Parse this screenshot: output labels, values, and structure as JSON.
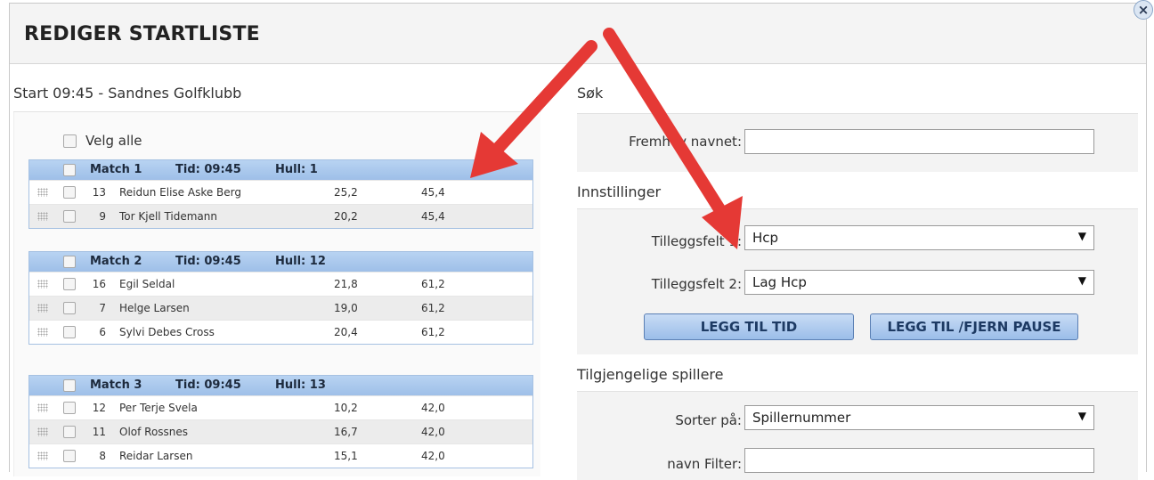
{
  "dialog": {
    "title": "REDIGER STARTLISTE",
    "close_glyph": "×"
  },
  "left": {
    "heading": "Start 09:45 - Sandnes Golfklubb",
    "select_all_label": "Velg alle",
    "matches": [
      {
        "match": "Match 1",
        "time": "Tid: 09:45",
        "hole": "Hull: 1",
        "players": [
          {
            "num": "13",
            "name": "Reidun Elise Aske Berg",
            "hcp": "25,2",
            "lag": "45,4"
          },
          {
            "num": "9",
            "name": "Tor Kjell Tidemann",
            "hcp": "20,2",
            "lag": "45,4"
          }
        ]
      },
      {
        "match": "Match 2",
        "time": "Tid: 09:45",
        "hole": "Hull: 12",
        "players": [
          {
            "num": "16",
            "name": "Egil Seldal",
            "hcp": "21,8",
            "lag": "61,2"
          },
          {
            "num": "7",
            "name": "Helge Larsen",
            "hcp": "19,0",
            "lag": "61,2"
          },
          {
            "num": "6",
            "name": "Sylvi Debes Cross",
            "hcp": "20,4",
            "lag": "61,2"
          }
        ]
      },
      {
        "match": "Match 3",
        "time": "Tid: 09:45",
        "hole": "Hull: 13",
        "players": [
          {
            "num": "12",
            "name": "Per Terje Svela",
            "hcp": "10,2",
            "lag": "42,0"
          },
          {
            "num": "11",
            "name": "Olof Rossnes",
            "hcp": "16,7",
            "lag": "42,0"
          },
          {
            "num": "8",
            "name": "Reidar Larsen",
            "hcp": "15,1",
            "lag": "42,0"
          }
        ]
      }
    ]
  },
  "right": {
    "search": {
      "heading": "Søk",
      "label": "Fremhev navnet:",
      "value": ""
    },
    "settings": {
      "heading": "Innstillinger",
      "field1_label": "Tilleggsfelt 1:",
      "field1_value": "Hcp",
      "field2_label": "Tilleggsfelt 2:",
      "field2_value": "Lag Hcp",
      "add_time_button": "LEGG TIL TID",
      "pause_button": "LEGG TIL /FJERN PAUSE"
    },
    "available": {
      "heading": "Tilgjengelige spillere",
      "sort_label": "Sorter på:",
      "sort_value": "Spillernummer",
      "filter_label": "navn Filter:",
      "filter_value": ""
    }
  },
  "colors": {
    "match_header": "#a9c8ec",
    "button_face": "#b3cff0",
    "annotation_arrow": "#e53935"
  },
  "icons": {
    "dropdown_arrow": "▼",
    "drag_handle": "drag-handle-icon",
    "close": "close-icon"
  }
}
